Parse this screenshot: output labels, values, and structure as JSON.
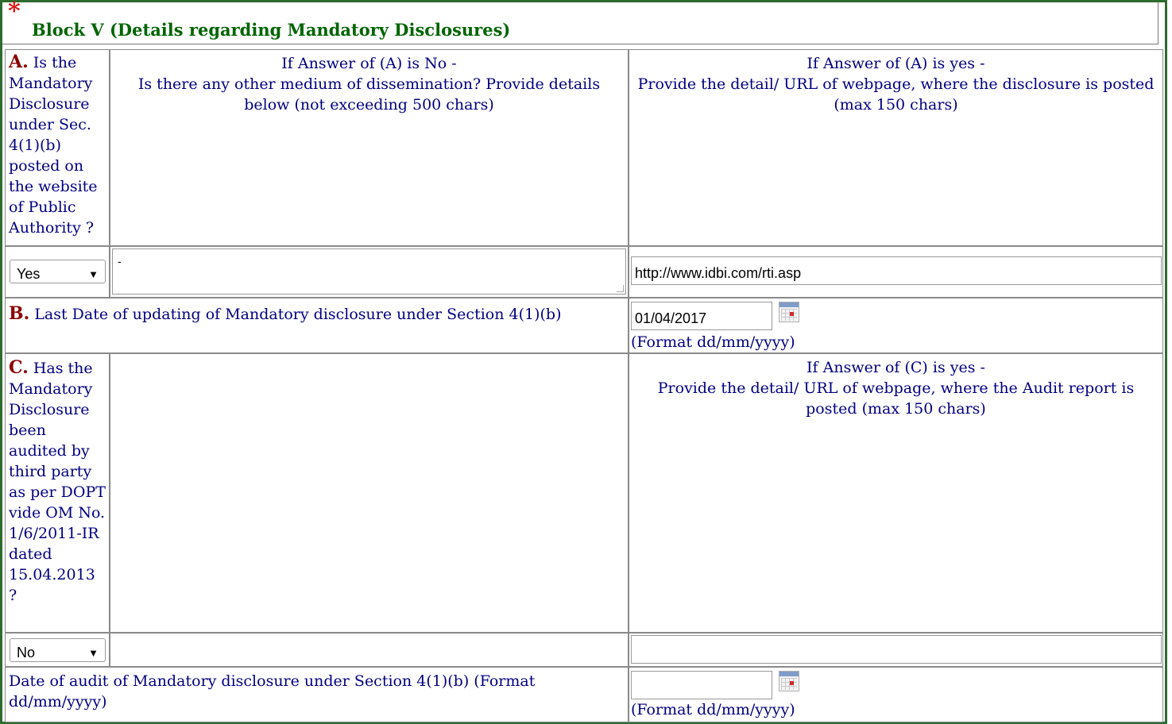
{
  "block": {
    "star": "*",
    "title": "Block V (Details regarding Mandatory Disclosures)"
  },
  "sectionA": {
    "label": "A.",
    "question": "Is the Mandatory Disclosure under Sec. 4(1)(b) posted on the website of Public Authority ?",
    "noHeader1": "If Answer of (A) is No -",
    "noHeader2": "Is there any other medium of dissemination? Provide details below (not exceeding 500 chars)",
    "yesHeader1": "If Answer of (A) is yes -",
    "yesHeader2": "Provide the detail/ URL of webpage, where the disclosure is posted (max 150 chars)",
    "selectValue": "Yes",
    "textareaValue": "-",
    "urlValue": "http://www.idbi.com/rti.asp"
  },
  "sectionB": {
    "label": "B.",
    "question": "Last Date of updating of Mandatory disclosure under Section 4(1)(b)",
    "dateValue": "01/04/2017",
    "format": "(Format dd/mm/yyyy)"
  },
  "sectionC": {
    "label": "C.",
    "question": "Has the Mandatory Disclosure been audited by third party as per DOPT vide OM No. 1/6/2011-IR dated 15.04.2013 ?",
    "yesHeader1": "If Answer of (C) is yes -",
    "yesHeader2": "Provide the detail/ URL of webpage, where the Audit report is posted (max 150 chars)",
    "selectValue": "No",
    "urlValue": ""
  },
  "auditDate": {
    "question": "Date of audit of Mandatory disclosure under Section 4(1)(b) (Format dd/mm/yyyy)",
    "dateValue": "",
    "format": "(Format dd/mm/yyyy)"
  },
  "icons": {
    "dropdown": "▼",
    "calendar": "calendar-icon"
  }
}
